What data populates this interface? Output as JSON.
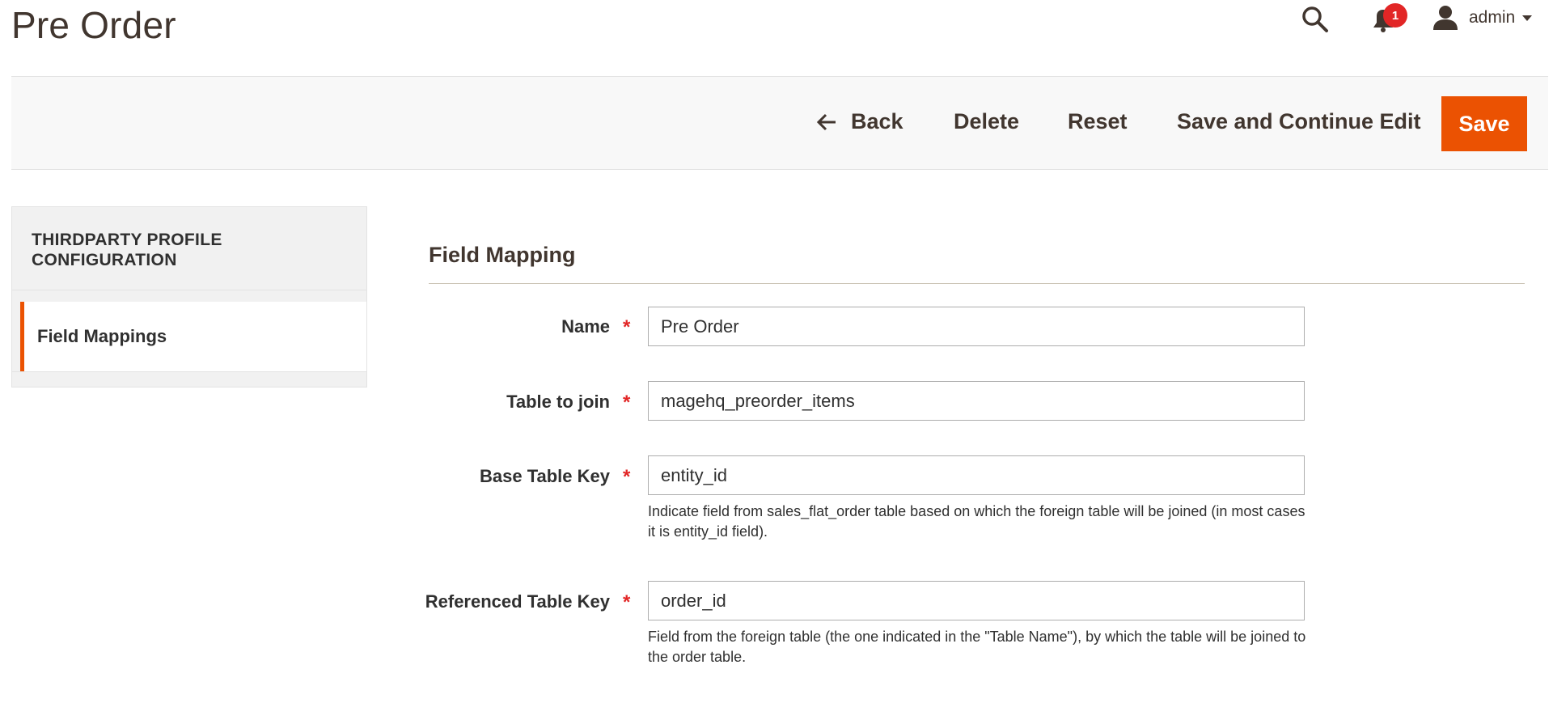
{
  "header": {
    "title": "Pre Order",
    "notifications_count": "1",
    "user_name": "admin",
    "icons": [
      "search-icon",
      "bell-icon",
      "user-icon",
      "caret-down-icon"
    ]
  },
  "toolbar": {
    "back_label": "Back",
    "delete_label": "Delete",
    "reset_label": "Reset",
    "save_continue_label": "Save and Continue Edit",
    "save_label": "Save",
    "accent_color": "#eb5202"
  },
  "sidebar": {
    "heading": "THIRDPARTY PROFILE CONFIGURATION",
    "items": [
      {
        "label": "Field Mappings",
        "active": true
      }
    ]
  },
  "form": {
    "section_title": "Field Mapping",
    "fields": [
      {
        "label": "Name",
        "value": "Pre Order",
        "required": "*",
        "note": ""
      },
      {
        "label": "Table to join",
        "value": "magehq_preorder_items",
        "required": "*",
        "note": ""
      },
      {
        "label": "Base Table Key",
        "value": "entity_id",
        "required": "*",
        "note": "Indicate field from sales_flat_order table based on which the foreign table will be joined (in most cases it is entity_id field)."
      },
      {
        "label": "Referenced Table Key",
        "value": "order_id",
        "required": "*",
        "note": "Field from the foreign table (the one indicated in the \"Table Name\"), by which the table will be joined to the order table."
      }
    ]
  }
}
